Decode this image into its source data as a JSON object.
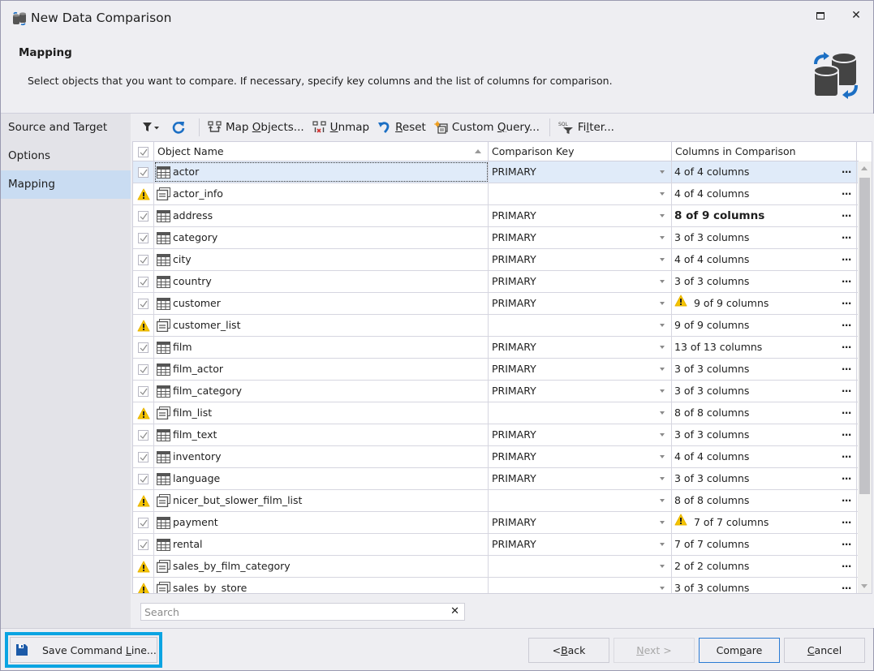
{
  "window": {
    "title": "New Data Comparison",
    "maximize_icon": "maximize-icon",
    "close_icon": "close-icon",
    "close_glyph": "✕"
  },
  "header": {
    "title": "Mapping",
    "description": "Select objects that you want to compare. If necessary, specify key columns and the list of columns for comparison."
  },
  "sidebar": {
    "items": [
      {
        "label": "Source and Target",
        "active": false
      },
      {
        "label": "Options",
        "active": false
      },
      {
        "label": "Mapping",
        "active": true
      }
    ]
  },
  "toolbar": {
    "filter_icon": "filter-icon",
    "refresh_icon": "refresh-icon",
    "map_objects": {
      "pre": "Map ",
      "u": "O",
      "post": "bjects..."
    },
    "unmap": {
      "pre": "",
      "u": "U",
      "post": "nmap"
    },
    "reset": {
      "pre": "",
      "u": "R",
      "post": "eset"
    },
    "custom_query": {
      "pre": "Custom ",
      "u": "Q",
      "post": "uery..."
    },
    "filter": {
      "pre": "Fi",
      "u": "l",
      "post": "ter..."
    }
  },
  "grid": {
    "columns": {
      "name": "Object Name",
      "key": "Comparison Key",
      "cols": "Columns in Comparison"
    },
    "sort": {
      "column": "Object Name",
      "direction": "ascending"
    },
    "rows": [
      {
        "name": "actor",
        "type": "table",
        "status": "checked",
        "key": "PRIMARY",
        "cols": "4 of 4 columns",
        "cols_warn": false,
        "cols_bold": false,
        "selected": true
      },
      {
        "name": "actor_info",
        "type": "view",
        "status": "warning",
        "key": "",
        "cols": "4 of 4 columns",
        "cols_warn": false,
        "cols_bold": false
      },
      {
        "name": "address",
        "type": "table",
        "status": "checked",
        "key": "PRIMARY",
        "cols": "8 of 9 columns",
        "cols_warn": false,
        "cols_bold": true
      },
      {
        "name": "category",
        "type": "table",
        "status": "checked",
        "key": "PRIMARY",
        "cols": "3 of 3 columns",
        "cols_warn": false,
        "cols_bold": false
      },
      {
        "name": "city",
        "type": "table",
        "status": "checked",
        "key": "PRIMARY",
        "cols": "4 of 4 columns",
        "cols_warn": false,
        "cols_bold": false
      },
      {
        "name": "country",
        "type": "table",
        "status": "checked",
        "key": "PRIMARY",
        "cols": "3 of 3 columns",
        "cols_warn": false,
        "cols_bold": false
      },
      {
        "name": "customer",
        "type": "table",
        "status": "checked",
        "key": "PRIMARY",
        "cols": "9 of 9 columns",
        "cols_warn": true,
        "cols_bold": false
      },
      {
        "name": "customer_list",
        "type": "view",
        "status": "warning",
        "key": "",
        "cols": "9 of 9 columns",
        "cols_warn": false,
        "cols_bold": false
      },
      {
        "name": "film",
        "type": "table",
        "status": "checked",
        "key": "PRIMARY",
        "cols": "13 of 13 columns",
        "cols_warn": false,
        "cols_bold": false
      },
      {
        "name": "film_actor",
        "type": "table",
        "status": "checked",
        "key": "PRIMARY",
        "cols": "3 of 3 columns",
        "cols_warn": false,
        "cols_bold": false
      },
      {
        "name": "film_category",
        "type": "table",
        "status": "checked",
        "key": "PRIMARY",
        "cols": "3 of 3 columns",
        "cols_warn": false,
        "cols_bold": false
      },
      {
        "name": "film_list",
        "type": "view",
        "status": "warning",
        "key": "",
        "cols": "8 of 8 columns",
        "cols_warn": false,
        "cols_bold": false
      },
      {
        "name": "film_text",
        "type": "table",
        "status": "checked",
        "key": "PRIMARY",
        "cols": "3 of 3 columns",
        "cols_warn": false,
        "cols_bold": false
      },
      {
        "name": "inventory",
        "type": "table",
        "status": "checked",
        "key": "PRIMARY",
        "cols": "4 of 4 columns",
        "cols_warn": false,
        "cols_bold": false
      },
      {
        "name": "language",
        "type": "table",
        "status": "checked",
        "key": "PRIMARY",
        "cols": "3 of 3 columns",
        "cols_warn": false,
        "cols_bold": false
      },
      {
        "name": "nicer_but_slower_film_list",
        "type": "view",
        "status": "warning",
        "key": "",
        "cols": "8 of 8 columns",
        "cols_warn": false,
        "cols_bold": false
      },
      {
        "name": "payment",
        "type": "table",
        "status": "checked",
        "key": "PRIMARY",
        "cols": "7 of 7 columns",
        "cols_warn": true,
        "cols_bold": false
      },
      {
        "name": "rental",
        "type": "table",
        "status": "checked",
        "key": "PRIMARY",
        "cols": "7 of 7 columns",
        "cols_warn": false,
        "cols_bold": false
      },
      {
        "name": "sales_by_film_category",
        "type": "view",
        "status": "warning",
        "key": "",
        "cols": "2 of 2 columns",
        "cols_warn": false,
        "cols_bold": false
      },
      {
        "name": "sales_by_store",
        "type": "view",
        "status": "warning",
        "key": "",
        "cols": "3 of 3 columns",
        "cols_warn": false,
        "cols_bold": false
      }
    ],
    "ellipsis": "···"
  },
  "search": {
    "placeholder": "Search",
    "value": "",
    "clear_glyph": "✕"
  },
  "footer": {
    "save_command_line": {
      "pre": "Save Command ",
      "u": "L",
      "post": "ine..."
    },
    "back": {
      "pre": "< ",
      "u": "B",
      "post": "ack"
    },
    "next": {
      "pre": "",
      "u": "N",
      "post": "ext >",
      "enabled": false
    },
    "compare": {
      "pre": "Com",
      "u": "p",
      "post": "are"
    },
    "cancel": {
      "pre": "",
      "u": "C",
      "post": "ancel"
    }
  },
  "colors": {
    "accent": "#0aa4e2",
    "selection": "#c9dcf2",
    "row_selected": "#e0ebf9",
    "warning": "#f5c400",
    "icon_blue": "#1c6fc4"
  }
}
